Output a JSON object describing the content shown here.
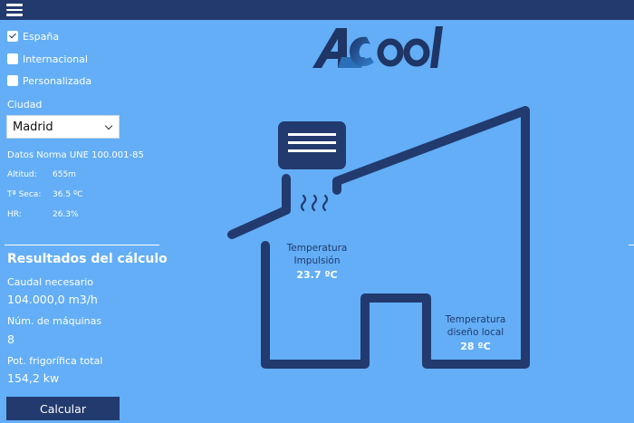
{
  "menu": {
    "icon": "hamburger-menu-icon"
  },
  "options": [
    {
      "label": "España",
      "checked": true
    },
    {
      "label": "Internacional",
      "checked": false
    },
    {
      "label": "Personalizada",
      "checked": false
    }
  ],
  "city": {
    "label": "Ciudad",
    "selected": "Madrid"
  },
  "norm": {
    "title": "Datos Norma UNE 100.001-85",
    "altitude_label": "Altitud:",
    "altitude_value": "655m",
    "temp_label": "Tª Seca:",
    "temp_value": "36.5 ºC",
    "hr_label": "HR:",
    "hr_value": "26.3%"
  },
  "results": {
    "title": "Resultados del cálculo",
    "flow_label": "Caudal necesario",
    "flow_value": "104.000,0 m3/h",
    "machines_label": "Núm. de máquinas",
    "machines_value": "8",
    "power_label": "Pot. frigorífica total",
    "power_value": "154,2 kw"
  },
  "actions": {
    "calculate": "Calcular"
  },
  "logo": {
    "text": "ACool"
  },
  "house": {
    "supply_label_1": "Temperatura",
    "supply_label_2": "Impulsión",
    "supply_value": "23.7 ºC",
    "design_label_1": "Temperatura",
    "design_label_2": "diseño local",
    "design_value": "28 ºC"
  },
  "colors": {
    "background": "#63aef6",
    "navy": "#223a6e",
    "white": "#ffffff"
  }
}
